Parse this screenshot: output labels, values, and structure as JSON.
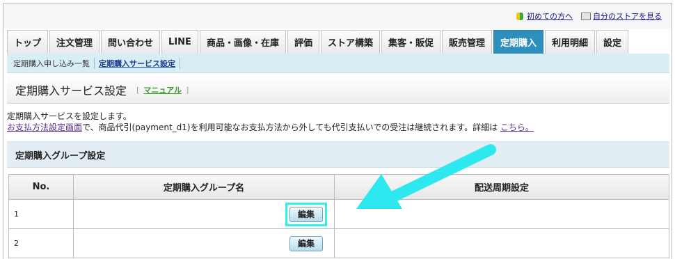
{
  "top_links": {
    "beginner": "初めての方へ",
    "my_store": "自分のストアを見る"
  },
  "nav": {
    "tabs": [
      "トップ",
      "注文管理",
      "問い合わせ",
      "LINE",
      "商品・画像・在庫",
      "評価",
      "ストア構築",
      "集客・販促",
      "販売管理",
      "定期購入",
      "利用明細",
      "設定"
    ],
    "active": "定期購入"
  },
  "subnav": {
    "items": [
      "定期購入申し込み一覧",
      "定期購入サービス設定"
    ],
    "current": "定期購入サービス設定"
  },
  "page": {
    "title": "定期購入サービス設定",
    "manual_link": "マニュアル"
  },
  "description": {
    "line1": "定期購入サービスを設定します。",
    "link1": "お支払方法設定画面",
    "line2": "で、商品代引(payment_d1)を利用可能なお支払方法から外しても代引支払いでの受注は継続されます。詳細は",
    "link2": "こちら。"
  },
  "section": {
    "title": "定期購入グループ設定"
  },
  "table": {
    "headers": [
      "No.",
      "定期購入グループ名",
      "配送周期設定"
    ],
    "rows": [
      {
        "no": "1",
        "edit": "編集"
      },
      {
        "no": "2",
        "edit": "編集"
      }
    ]
  },
  "colors": {
    "active_tab": "#2e8fbd",
    "highlight": "#2ef0f0",
    "subnav_bg": "#d8eef5"
  }
}
